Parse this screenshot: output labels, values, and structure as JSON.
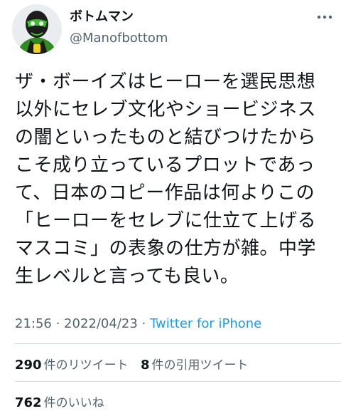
{
  "user": {
    "display_name": "ボトムマン",
    "handle": "@Manofbottom",
    "avatar_icon": "masked-superhero-avatar",
    "accent_color": "#3cbf2c"
  },
  "more_icon": "more-options-icon",
  "tweet": {
    "lines": [
      "ザ・ボーイズはヒーローを選民思想",
      "以外にセレブ文化やショービジネス",
      "の闇といったものと結びつけたから",
      "こそ成り立っているプロットであっ",
      "て、日本のコピー作品は何よりこの",
      "「ヒーローをセレブに仕立て上げる",
      "マスコミ」の表象の仕方が雑。中学",
      "生レベルと言っても良い。"
    ]
  },
  "meta": {
    "time": "21:56",
    "separator": " · ",
    "date": "2022/04/23",
    "source": "Twitter for iPhone",
    "source_color": "#1d9bf0"
  },
  "stats": {
    "retweets_count": "290",
    "retweets_label": "件のリツイート",
    "quotes_count": "8",
    "quotes_label": "件の引用ツイート",
    "likes_count": "762",
    "likes_label": "件のいいね"
  }
}
